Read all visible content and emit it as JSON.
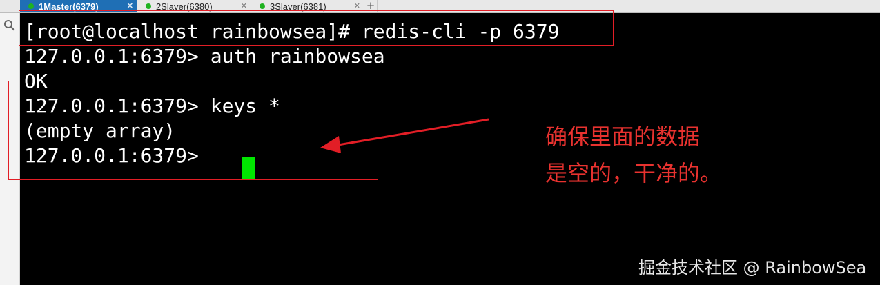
{
  "tabs": [
    {
      "number": "1",
      "title": "Master(6379)",
      "status_color": "#1fb321",
      "active": true
    },
    {
      "number": "2",
      "title": "Slaver(6380)",
      "status_color": "#1fb321",
      "active": false
    },
    {
      "number": "3",
      "title": "Slaver(6381)",
      "status_color": "#1fb321",
      "active": false
    }
  ],
  "terminal": {
    "lines": [
      "[root@localhost rainbowsea]# redis-cli -p 6379",
      "127.0.0.1:6379> auth rainbowsea",
      "OK",
      "127.0.0.1:6379> keys *",
      "(empty array)",
      "127.0.0.1:6379> "
    ]
  },
  "annotation": {
    "line1": "确保里面的数据",
    "line2": "是空的，干净的。"
  },
  "watermark": "掘金技术社区 @ RainbowSea",
  "colors": {
    "terminal_bg": "#000000",
    "terminal_text": "#ffffff",
    "cursor": "#00e600",
    "annotation": "#e21e26",
    "active_tab": "#1f6fb5"
  }
}
